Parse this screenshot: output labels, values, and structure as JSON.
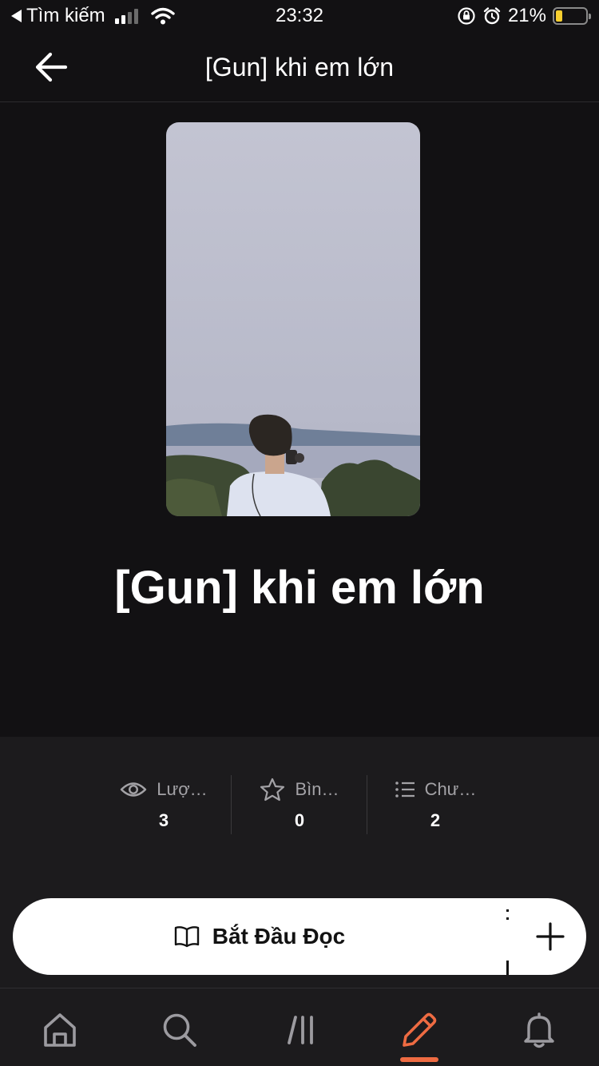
{
  "status_bar": {
    "back_app": "Tìm kiếm",
    "time": "23:32",
    "battery": "21%",
    "battery_level": 0.21
  },
  "nav": {
    "title": "[Gun] khi em lớn"
  },
  "story": {
    "title": "[Gun] khi em lớn"
  },
  "stats": [
    {
      "icon": "eye-icon",
      "label": "Lượ…",
      "value": "3"
    },
    {
      "icon": "star-icon",
      "label": "Bìn…",
      "value": "0"
    },
    {
      "icon": "list-icon",
      "label": "Chư…",
      "value": "2"
    }
  ],
  "cta": {
    "read_label": "Bắt Đầu Đọc",
    "add_icon": "plus-icon"
  },
  "tabs": [
    {
      "name": "home",
      "icon": "home-icon"
    },
    {
      "name": "search",
      "icon": "search-icon"
    },
    {
      "name": "library",
      "icon": "library-icon"
    },
    {
      "name": "write",
      "icon": "pencil-icon",
      "active": true
    },
    {
      "name": "notifications",
      "icon": "bell-icon"
    }
  ],
  "colors": {
    "background": "#121113",
    "panel": "#1c1b1d",
    "accent": "#ee6b42",
    "battery": "#f7cf2f"
  }
}
